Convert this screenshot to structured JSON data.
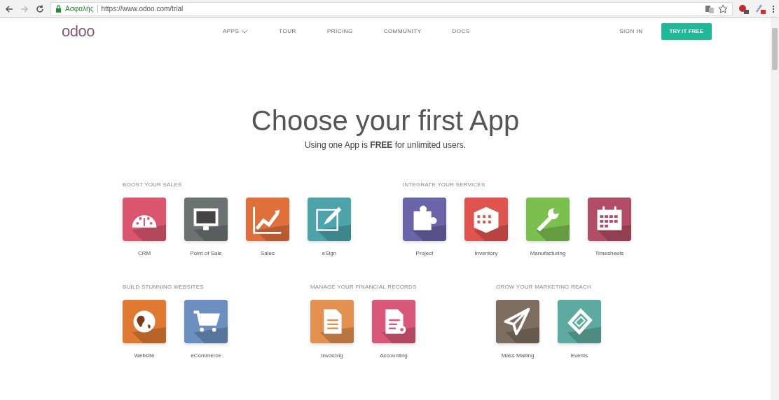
{
  "browser": {
    "security": "Ασφαλής",
    "url": "https://www.odoo.com/trial"
  },
  "navbar": {
    "logo": "odoo",
    "links": [
      "APPS",
      "TOUR",
      "PRICING",
      "COMMUNITY",
      "DOCS"
    ],
    "sign_in": "SIGN IN",
    "cta": "TRY IT FREE"
  },
  "hero": {
    "title": "Choose your first App",
    "subtitle": "Using one App is **FREE** for unlimited users."
  },
  "groups": [
    {
      "heading": "BOOST YOUR SALES",
      "apps": [
        {
          "label": "CRM",
          "color": "#d9566e"
        },
        {
          "label": "Point of Sale",
          "color": "#6c7272"
        },
        {
          "label": "Sales",
          "color": "#e0703b"
        },
        {
          "label": "eSign",
          "color": "#4ea3ab"
        }
      ]
    },
    {
      "heading": "INTEGRATE YOUR SERVICES",
      "apps": [
        {
          "label": "Project",
          "color": "#6a65a8"
        },
        {
          "label": "Inventory",
          "color": "#e0544f"
        },
        {
          "label": "Manufacturing",
          "color": "#7bbf4e"
        },
        {
          "label": "Timesheets",
          "color": "#b24d67"
        }
      ]
    },
    {
      "heading": "BUILD STUNNING WEBSITES",
      "apps": [
        {
          "label": "Website",
          "color": "#e07a32"
        },
        {
          "label": "eCommerce",
          "color": "#6c8fbf"
        }
      ]
    },
    {
      "heading": "MANAGE YOUR FINANCIAL RECORDS",
      "apps": [
        {
          "label": "Invoicing",
          "color": "#e39150"
        },
        {
          "label": "Accounting",
          "color": "#d9587a"
        }
      ]
    },
    {
      "heading": "GROW YOUR MARKETING REACH",
      "apps": [
        {
          "label": "Mass Mailing",
          "color": "#7d6e60"
        },
        {
          "label": "Events",
          "color": "#5eaaa0"
        }
      ]
    }
  ]
}
